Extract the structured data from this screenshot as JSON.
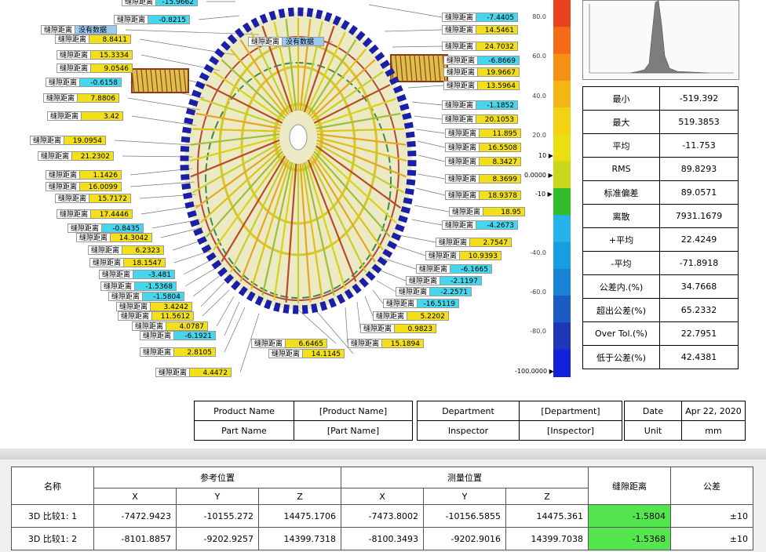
{
  "labels": [
    {
      "key": "缝隙距离",
      "value": "-15.9662",
      "color": "c"
    },
    {
      "key": "缝隙距离",
      "value": "-0.8215",
      "color": "c"
    },
    {
      "key": "缝隙距离",
      "value": "没有数据",
      "color": "b"
    },
    {
      "key": "缝隙距离",
      "value": "8.8411",
      "color": "y"
    },
    {
      "key": "缝隙距离",
      "value": "15.3334",
      "color": "y"
    },
    {
      "key": "缝隙距离",
      "value": "9.0546",
      "color": "y"
    },
    {
      "key": "缝隙距离",
      "value": "-0.6158",
      "color": "c"
    },
    {
      "key": "缝隙距离",
      "value": "7.8806",
      "color": "y"
    },
    {
      "key": "缝隙距离",
      "value": "3.42",
      "color": "y"
    },
    {
      "key": "缝隙距离",
      "value": "19.0954",
      "color": "y"
    },
    {
      "key": "缝隙距离",
      "value": "21.2302",
      "color": "y"
    },
    {
      "key": "缝隙距离",
      "value": "1.1426",
      "color": "y"
    },
    {
      "key": "缝隙距离",
      "value": "16.0099",
      "color": "y"
    },
    {
      "key": "缝隙距离",
      "value": "15.7172",
      "color": "y"
    },
    {
      "key": "缝隙距离",
      "value": "17.4446",
      "color": "y"
    },
    {
      "key": "缝隙距离",
      "value": "-0.8435",
      "color": "c"
    },
    {
      "key": "缝隙距离",
      "value": "14.3042",
      "color": "y"
    },
    {
      "key": "缝隙距离",
      "value": "6.2323",
      "color": "y"
    },
    {
      "key": "缝隙距离",
      "value": "18.1547",
      "color": "y"
    },
    {
      "key": "缝隙距离",
      "value": "-3.481",
      "color": "c"
    },
    {
      "key": "缝隙距离",
      "value": "-1.5368",
      "color": "c"
    },
    {
      "key": "缝隙距离",
      "value": "-1.5804",
      "color": "c"
    },
    {
      "key": "缝隙距离",
      "value": "3.4242",
      "color": "y"
    },
    {
      "key": "缝隙距离",
      "value": "11.5612",
      "color": "y"
    },
    {
      "key": "缝隙距离",
      "value": "4.0787",
      "color": "y"
    },
    {
      "key": "缝隙距离",
      "value": "-6.1921",
      "color": "c"
    },
    {
      "key": "缝隙距离",
      "value": "2.8105",
      "color": "y"
    },
    {
      "key": "缝隙距离",
      "value": "4.4472",
      "color": "y"
    },
    {
      "key": "缝隙距离",
      "value": "没有数据",
      "color": "b"
    },
    {
      "key": "缝隙距离",
      "value": "6.6465",
      "color": "y"
    },
    {
      "key": "缝隙距离",
      "value": "14.1145",
      "color": "y"
    },
    {
      "key": "缝隙距离",
      "value": "15.1894",
      "color": "y"
    },
    {
      "key": "缝隙距离",
      "value": "0.9823",
      "color": "y"
    },
    {
      "key": "缝隙距离",
      "value": "5.2202",
      "color": "y"
    },
    {
      "key": "缝隙距离",
      "value": "-16.5119",
      "color": "c"
    },
    {
      "key": "缝隙距离",
      "value": "-2.2571",
      "color": "c"
    },
    {
      "key": "缝隙距离",
      "value": "-2.1197",
      "color": "c"
    },
    {
      "key": "缝隙距离",
      "value": "-6.1665",
      "color": "c"
    },
    {
      "key": "缝隙距离",
      "value": "10.9393",
      "color": "y"
    },
    {
      "key": "缝隙距离",
      "value": "2.7547",
      "color": "y"
    },
    {
      "key": "缝隙距离",
      "value": "-7.4405",
      "color": "c"
    },
    {
      "key": "缝隙距离",
      "value": "14.5461",
      "color": "y"
    },
    {
      "key": "缝隙距离",
      "value": "24.7032",
      "color": "y"
    },
    {
      "key": "缝隙距离",
      "value": "-6.8669",
      "color": "c"
    },
    {
      "key": "缝隙距离",
      "value": "19.9667",
      "color": "y"
    },
    {
      "key": "缝隙距离",
      "value": "13.5964",
      "color": "y"
    },
    {
      "key": "缝隙距离",
      "value": "-1.1852",
      "color": "c"
    },
    {
      "key": "缝隙距离",
      "value": "20.1053",
      "color": "y"
    },
    {
      "key": "缝隙距离",
      "value": "11.895",
      "color": "y"
    },
    {
      "key": "缝隙距离",
      "value": "16.5508",
      "color": "y"
    },
    {
      "key": "缝隙距离",
      "value": "8.3427",
      "color": "y"
    },
    {
      "key": "缝隙距离",
      "value": "8.3699",
      "color": "y"
    },
    {
      "key": "缝隙距离",
      "value": "18.9378",
      "color": "y"
    },
    {
      "key": "缝隙距离",
      "value": "18.95",
      "color": "y"
    },
    {
      "key": "缝隙距离",
      "value": "-4.2673",
      "color": "c"
    }
  ],
  "colorbar": {
    "ticks": [
      "80.0",
      "60.0",
      "40.0",
      "20.0",
      "-40.0",
      "-60.0",
      "-80.0"
    ],
    "marks": [
      "10",
      "0.0000",
      "-10",
      "-100.0000"
    ],
    "colors": [
      "#e8421c",
      "#f36a17",
      "#f58f16",
      "#f5b515",
      "#f3d214",
      "#e9df12",
      "#c9d91a",
      "#33bd2c",
      "#25b3e9",
      "#1a9ee2",
      "#1783d5",
      "#1a5bc4",
      "#1f36b8",
      "#1220d9"
    ]
  },
  "stats": [
    {
      "label": "最小",
      "value": "-519.392"
    },
    {
      "label": "最大",
      "value": "519.3853"
    },
    {
      "label": "平均",
      "value": "-11.753"
    },
    {
      "label": "RMS",
      "value": "89.8293"
    },
    {
      "label": "标准偏差",
      "value": "89.0571"
    },
    {
      "label": "离散",
      "value": "7931.1679"
    },
    {
      "label": "+平均",
      "value": "22.4249"
    },
    {
      "label": "-平均",
      "value": "-71.8918"
    },
    {
      "label": "公差内.(%)",
      "value": "34.7668"
    },
    {
      "label": "超出公差(%)",
      "value": "65.2332"
    },
    {
      "label": "Over Tol.(%)",
      "value": "22.7951"
    },
    {
      "label": "低于公差(%)",
      "value": "42.4381"
    }
  ],
  "info": {
    "product_label": "Product Name",
    "product_value": "[Product Name]",
    "part_label": "Part Name",
    "part_value": "[Part Name]",
    "dept_label": "Department",
    "dept_value": "[Department]",
    "insp_label": "Inspector",
    "insp_value": "[Inspector]",
    "date_label": "Date",
    "date_value": "Apr 22, 2020",
    "unit_label": "Unit",
    "unit_value": "mm"
  },
  "table": {
    "col_name": "名称",
    "col_ref": "参考位置",
    "col_meas": "测量位置",
    "col_gap": "缝隙距离",
    "col_tol": "公差",
    "x": "X",
    "y": "Y",
    "z": "Z",
    "rows": [
      {
        "name": "3D 比较1: 1",
        "rx": "-7472.9423",
        "ry": "-10155.272",
        "rz": "14475.1706",
        "mx": "-7473.8002",
        "my": "-10156.5855",
        "mz": "14475.361",
        "gap": "-1.5804",
        "tol": "±10"
      },
      {
        "name": "3D 比较1: 2",
        "rx": "-8101.8857",
        "ry": "-9202.9257",
        "rz": "14399.7318",
        "mx": "-8100.3493",
        "my": "-9202.9016",
        "mz": "14399.7038",
        "gap": "-1.5368",
        "tol": "±10"
      }
    ]
  }
}
